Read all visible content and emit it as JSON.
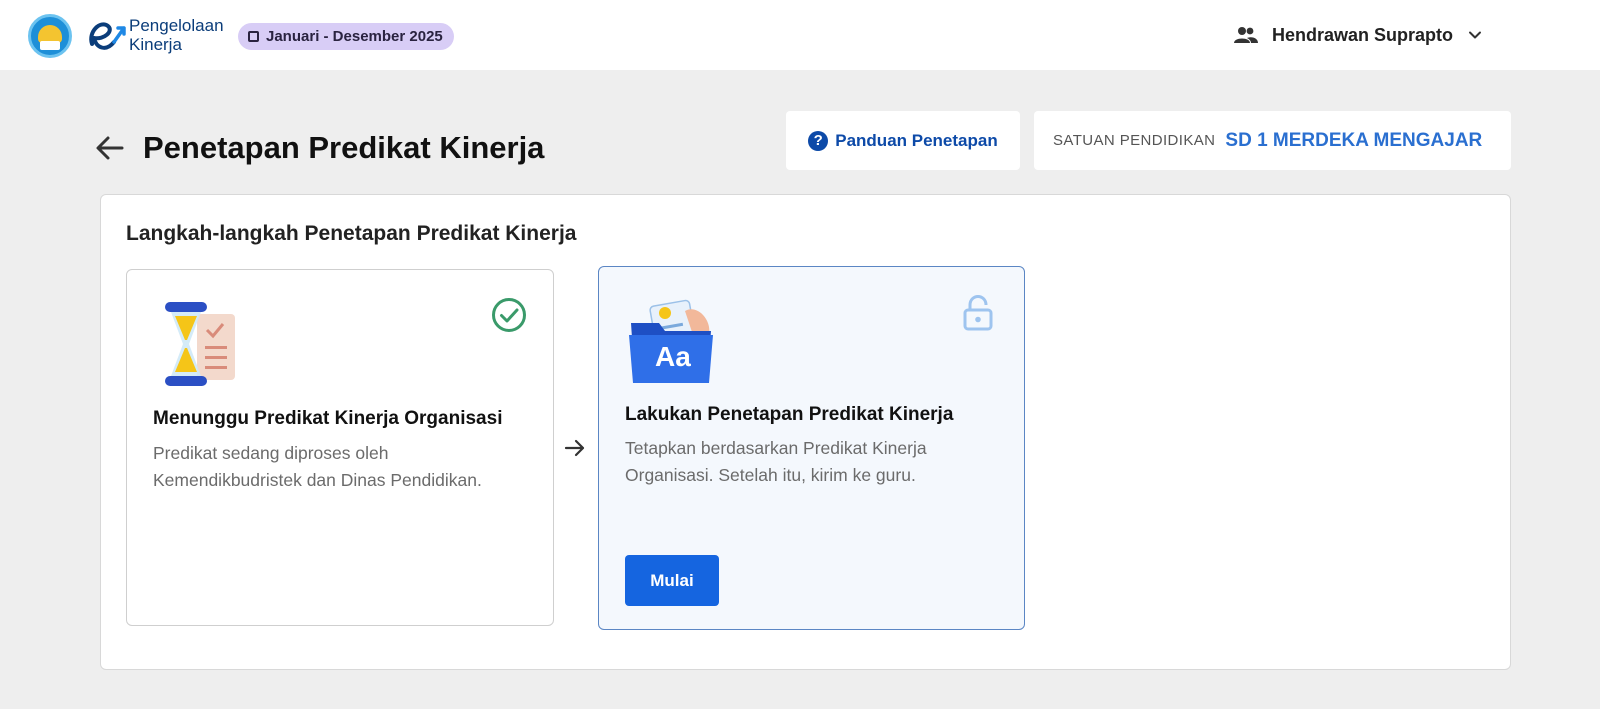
{
  "header": {
    "brand_line1": "Pengelolaan",
    "brand_line2": "Kinerja",
    "period_label": "Januari - Desember 2025",
    "user_name": "Hendrawan Suprapto",
    "icons": {
      "user": "people-icon",
      "dropdown": "chevron-down-icon",
      "period": "square-icon"
    }
  },
  "page": {
    "title": "Penetapan Predikat Kinerja",
    "guide_button": "Panduan Penetapan",
    "unit_label": "SATUAN PENDIDIKAN",
    "unit_value": "SD 1 MERDEKA MENGAJAR"
  },
  "steps_panel": {
    "title": "Langkah-langkah Penetapan Predikat Kinerja",
    "steps": [
      {
        "title": "Menunggu Predikat Kinerja Organisasi",
        "description": "Predikat sedang diproses oleh Kemendikbudristek dan Dinas Pendidikan.",
        "status_icon": "check-circle-icon",
        "illustration": "hourglass-icon"
      },
      {
        "title": "Lakukan Penetapan Predikat Kinerja",
        "description": "Tetapkan berdasarkan Predikat Kinerja Organisasi. Setelah itu, kirim ke guru.",
        "status_icon": "unlock-icon",
        "illustration": "folder-icon",
        "illustration_text": "Aa",
        "button_label": "Mulai"
      }
    ]
  },
  "colors": {
    "primary": "#1565e0",
    "link": "#0d4aa8",
    "unit_value": "#2a6fd0",
    "success": "#3a9a6a",
    "badge": "#d8cdf6",
    "active_border": "#5b86c4"
  }
}
